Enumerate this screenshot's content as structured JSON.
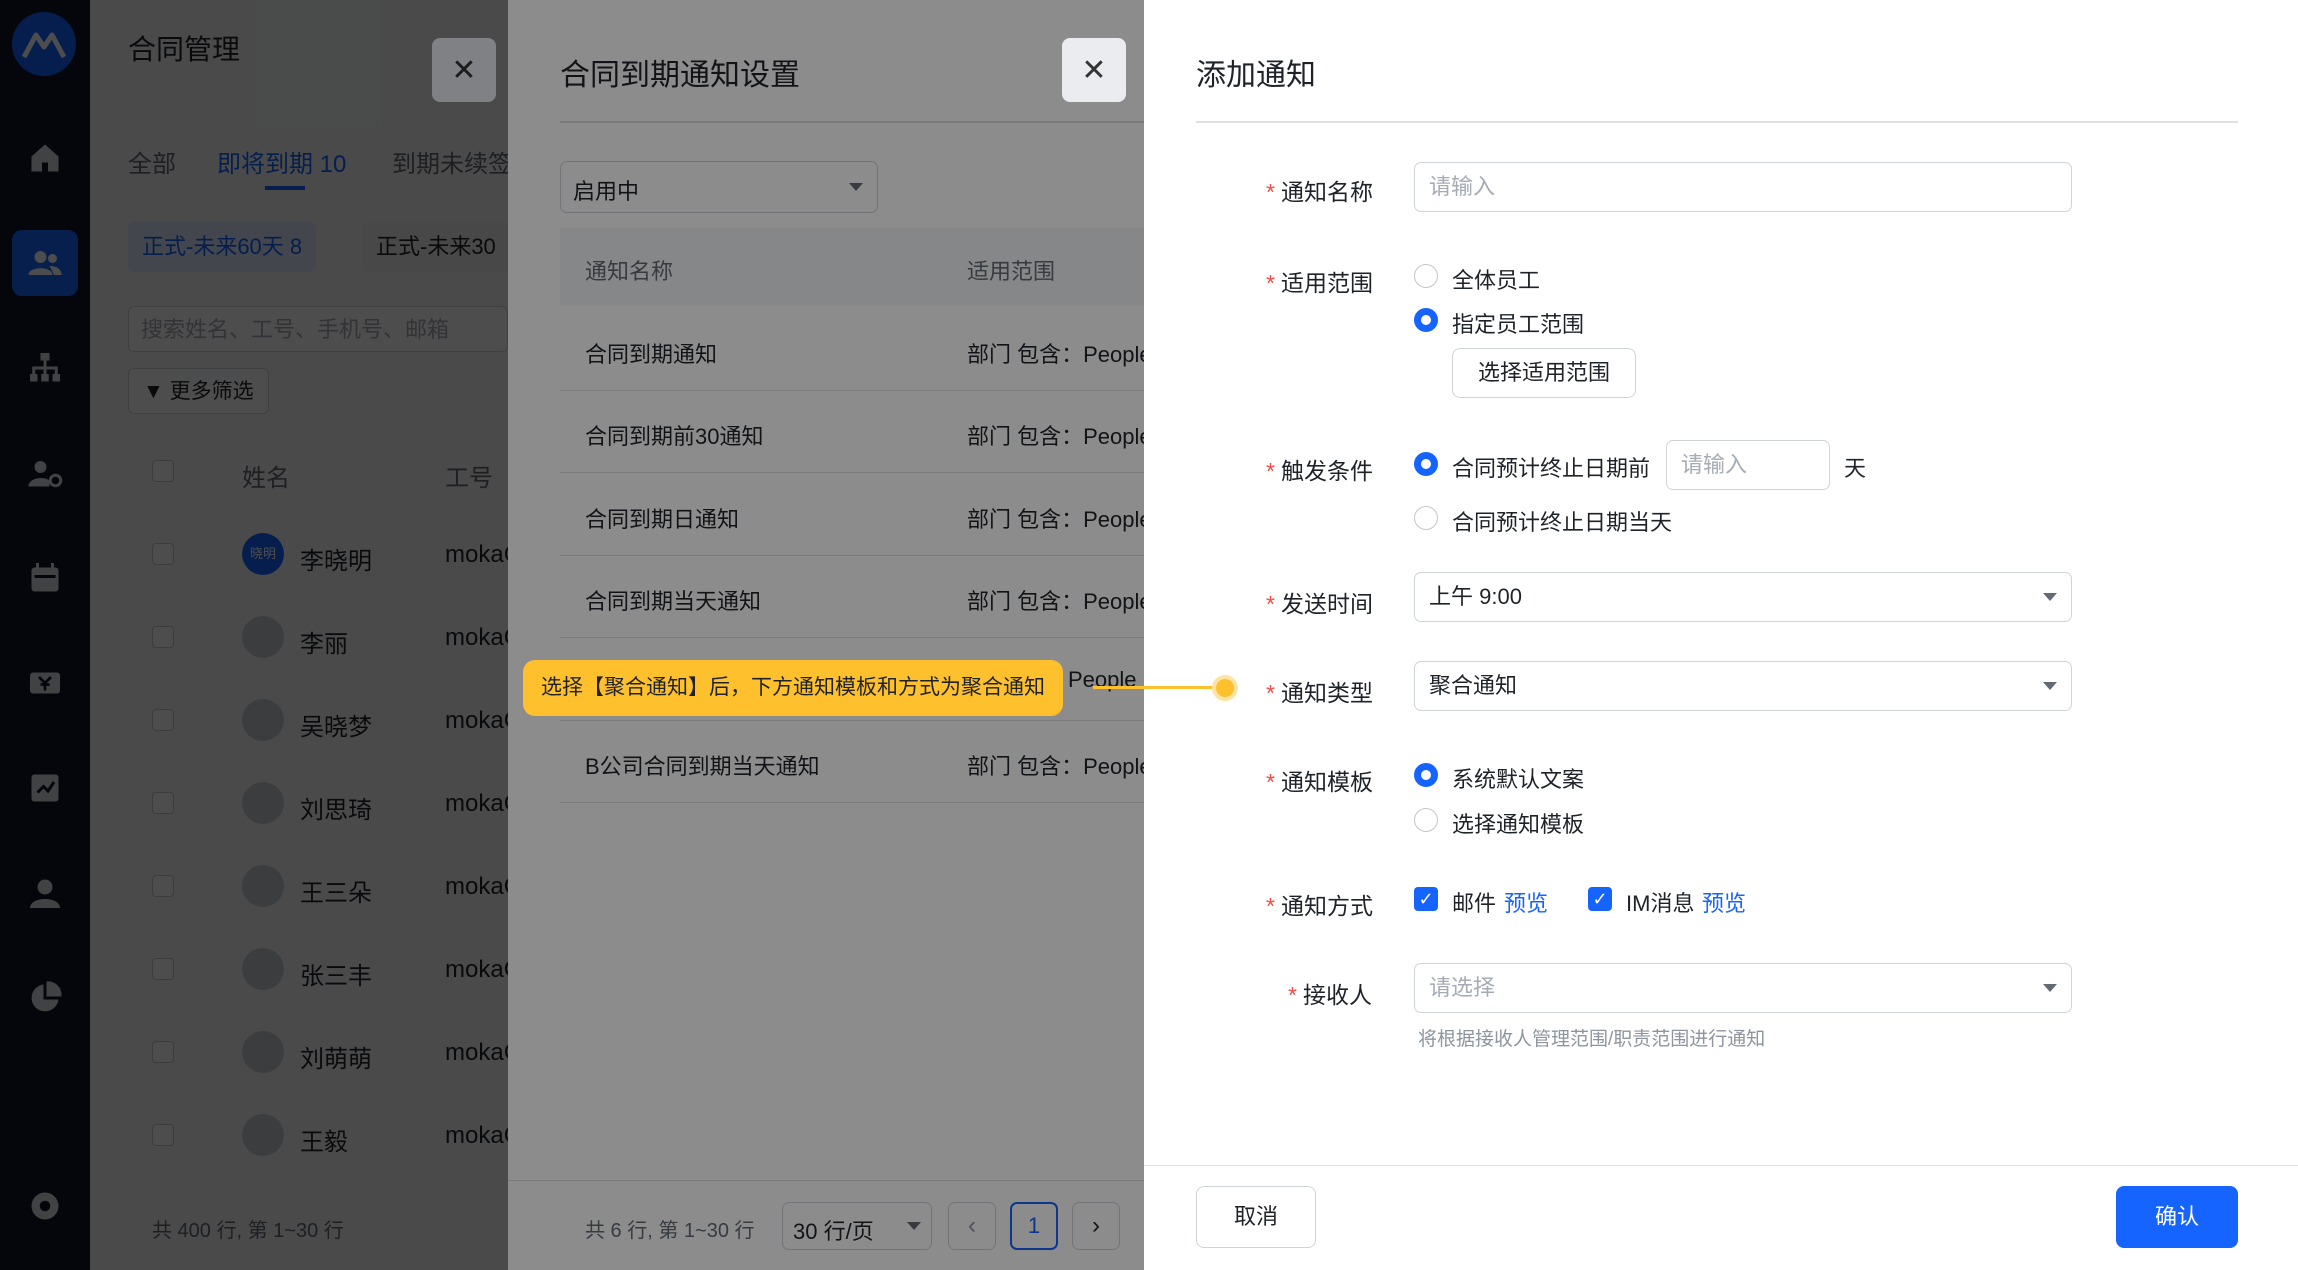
{
  "app": {
    "title": "合同管理",
    "tabs": [
      "全部",
      "即将到期 10",
      "到期未续签"
    ],
    "chips": [
      "正式-未来60天  8",
      "正式-未来30"
    ],
    "search_placeholder": "搜索姓名、工号、手机号、邮箱",
    "more_filter": "更多筛选",
    "columns": [
      "姓名",
      "工号"
    ],
    "rows": [
      {
        "name": "李晓明",
        "id": "mokaC",
        "avatar_text": "晓明"
      },
      {
        "name": "李丽",
        "id": "mokaC"
      },
      {
        "name": "吴晓梦",
        "id": "mokaC"
      },
      {
        "name": "刘思琦",
        "id": "mokaC"
      },
      {
        "name": "王三朵",
        "id": "mokaC"
      },
      {
        "name": "张三丰",
        "id": "mokaC"
      },
      {
        "name": "刘萌萌",
        "id": "mokaC"
      },
      {
        "name": "王毅",
        "id": "mokaC"
      }
    ],
    "footer": "共 400 行, 第 1~30 行"
  },
  "settings_panel": {
    "title": "合同到期通知设置",
    "status_filter": "启用中",
    "columns": [
      "通知名称",
      "适用范围"
    ],
    "rows": [
      {
        "name": "合同到期通知",
        "scope": "部门 包含：People"
      },
      {
        "name": "合同到期前30通知",
        "scope": "部门 包含：People"
      },
      {
        "name": "合同到期日通知",
        "scope": "部门 包含：People"
      },
      {
        "name": "合同到期当天通知",
        "scope": "部门 包含：People"
      },
      {
        "name": "",
        "scope": "People"
      },
      {
        "name": "B公司合同到期当天通知",
        "scope": "部门 包含：People"
      }
    ],
    "footer_count": "共 6 行, 第 1~30 行",
    "page_size": "30 行/页",
    "page": "1"
  },
  "tooltip": "选择【聚合通知】后，下方通知模板和方式为聚合通知",
  "form": {
    "title": "添加通知",
    "name": {
      "label": "通知名称",
      "placeholder": "请输入"
    },
    "scope": {
      "label": "适用范围",
      "options": [
        "全体员工",
        "指定员工范围"
      ],
      "selected": 1,
      "button": "选择适用范围"
    },
    "trigger": {
      "label": "触发条件",
      "option1": "合同预计终止日期前",
      "days_placeholder": "请输入",
      "unit": "天",
      "option2": "合同预计终止日期当天",
      "selected": 0
    },
    "send_time": {
      "label": "发送时间",
      "value": "上午 9:00"
    },
    "type": {
      "label": "通知类型",
      "value": "聚合通知"
    },
    "template": {
      "label": "通知模板",
      "options": [
        "系统默认文案",
        "选择通知模板"
      ],
      "selected": 0
    },
    "method": {
      "label": "通知方式",
      "email": "邮件",
      "im": "IM消息",
      "preview": "预览"
    },
    "receiver": {
      "label": "接收人",
      "placeholder": "请选择",
      "hint": "将根据接收人管理范围/职责范围进行通知"
    },
    "cancel": "取消",
    "confirm": "确认",
    "required_mark": "*"
  },
  "colors": {
    "primary": "#1664ff",
    "required": "#f54a45",
    "tooltip": "#ffc02e",
    "sidebar": "#11172a"
  }
}
